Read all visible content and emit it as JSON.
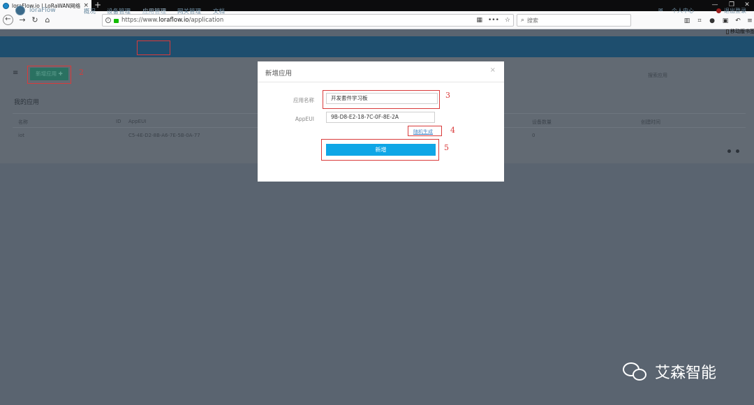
{
  "browser": {
    "tab_title": "loraFlow.io | LoRaWAN网络服",
    "tab_close": "×",
    "new_tab": "+",
    "url_prefix": "https://www.",
    "url_domain": "loraflow.io",
    "url_path": "/application",
    "search_placeholder": "搜索",
    "bookmark_label": "移动版书签",
    "window_controls": [
      "—",
      "❐",
      "✕"
    ]
  },
  "app": {
    "brand": "loraFlow",
    "nav": [
      "概况",
      "设备管理",
      "应用管理",
      "网关管理",
      "文档"
    ],
    "active_nav_index": 2,
    "right_items": [
      "消息",
      "个人中心",
      "退出登录"
    ],
    "new_app_button": "新增应用 ✚",
    "search_hint": "搜索应用",
    "section_title": "我的应用",
    "table_headers": [
      "名称",
      "ID",
      "AppEUI",
      "设备数量",
      "创建时间"
    ],
    "table_row": [
      "iot",
      "",
      "C5-4E-D2-8B-A6-7E-5B-0A-77",
      "0",
      ""
    ]
  },
  "modal": {
    "title": "新增应用",
    "close": "×",
    "name_label": "应用名称",
    "name_value": "开发套件学习板",
    "appeui_label": "AppEUI",
    "appeui_value": "9B-D8-E2-18-7C-0F-8E-2A",
    "random_link": "随机生成",
    "submit_button": "新增"
  },
  "annotations": [
    "2",
    "3",
    "4",
    "5"
  ],
  "watermark": "艾森智能",
  "colors": {
    "overlay": "#5a6470",
    "app_header": "#1e4e6e",
    "annotation_red": "#d93a3a",
    "primary_button": "#0fa6e6"
  }
}
